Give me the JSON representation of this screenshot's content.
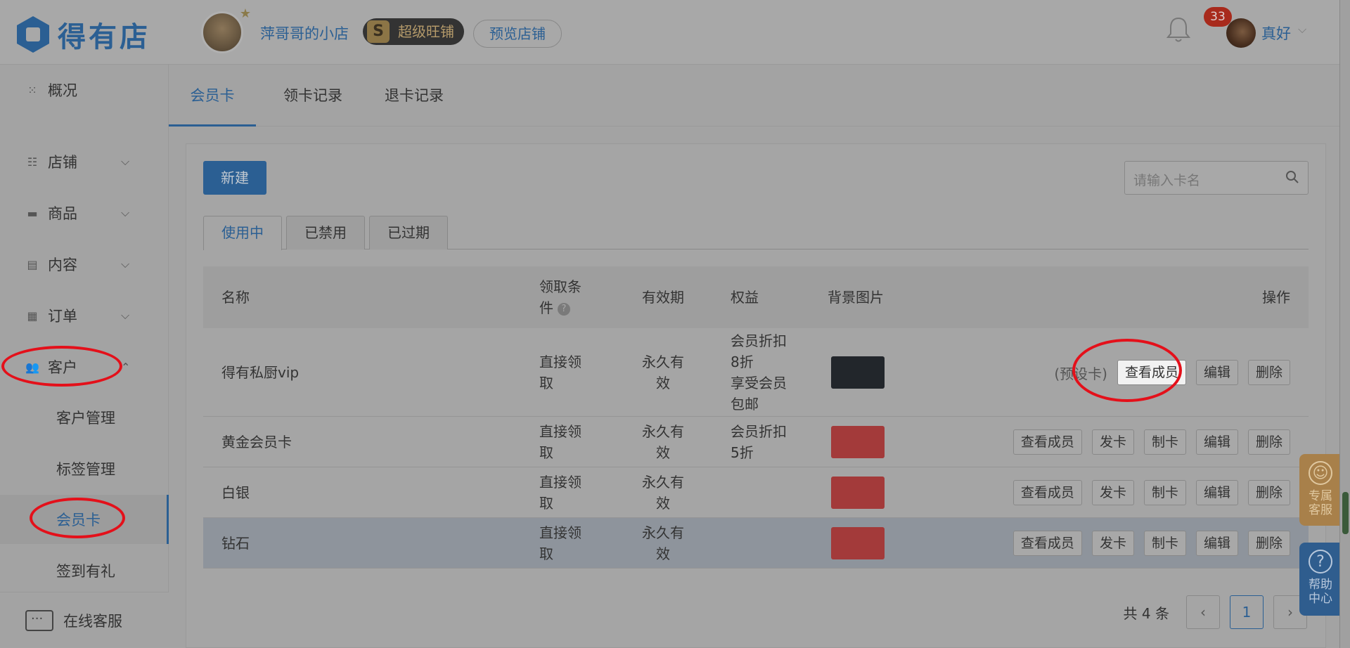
{
  "header": {
    "logo_text": "得有店",
    "shop_name": "萍哥哥的小店",
    "badge_letter": "S",
    "badge_label": "超级旺铺",
    "preview_label": "预览店铺",
    "notification_count": "33",
    "user_name": "真好"
  },
  "sidebar": {
    "overview": "概况",
    "store": "店铺",
    "goods": "商品",
    "content": "内容",
    "orders": "订单",
    "customers": "客户",
    "sub_items": [
      "客户管理",
      "标签管理",
      "会员卡",
      "签到有礼"
    ],
    "online_service": "在线客服"
  },
  "tabs": [
    "会员卡",
    "领卡记录",
    "退卡记录"
  ],
  "toolbar": {
    "new_label": "新建",
    "search_placeholder": "请输入卡名"
  },
  "subtabs": [
    "使用中",
    "已禁用",
    "已过期"
  ],
  "table": {
    "headers": {
      "name": "名称",
      "condition_line1": "领取条",
      "condition_line2": "件",
      "validity": "有效期",
      "rights": "权益",
      "background": "背景图片",
      "actions": "操作"
    },
    "rows": [
      {
        "name": "得有私厨vip",
        "condition": [
          "直接领",
          "取"
        ],
        "validity": [
          "永久有",
          "效"
        ],
        "rights": [
          "会员折扣",
          "8折",
          "享受会员",
          "包邮"
        ],
        "swatch": "#22262b",
        "preset": "(预设卡)",
        "actions": [
          "查看成员",
          "编辑",
          "删除"
        ]
      },
      {
        "name": "黄金会员卡",
        "condition": [
          "直接领",
          "取"
        ],
        "validity": [
          "永久有",
          "效"
        ],
        "rights": [
          "会员折扣",
          "5折"
        ],
        "swatch": "#a33a3a",
        "actions": [
          "查看成员",
          "发卡",
          "制卡",
          "编辑",
          "删除"
        ]
      },
      {
        "name": "白银",
        "condition": [
          "直接领",
          "取"
        ],
        "validity": [
          "永久有",
          "效"
        ],
        "rights": [],
        "swatch": "#a33a3a",
        "actions": [
          "查看成员",
          "发卡",
          "制卡",
          "编辑",
          "删除"
        ]
      },
      {
        "name": "钻石",
        "condition": [
          "直接领",
          "取"
        ],
        "validity": [
          "永久有",
          "效"
        ],
        "rights": [],
        "swatch": "#a33a3a",
        "actions": [
          "查看成员",
          "发卡",
          "制卡",
          "编辑",
          "删除"
        ]
      }
    ]
  },
  "pager": {
    "total": "共 4 条",
    "prev": "‹",
    "current": "1",
    "next": "›"
  },
  "float": {
    "service_line1": "专属",
    "service_line2": "客服",
    "help_line1": "帮助",
    "help_line2": "中心"
  }
}
